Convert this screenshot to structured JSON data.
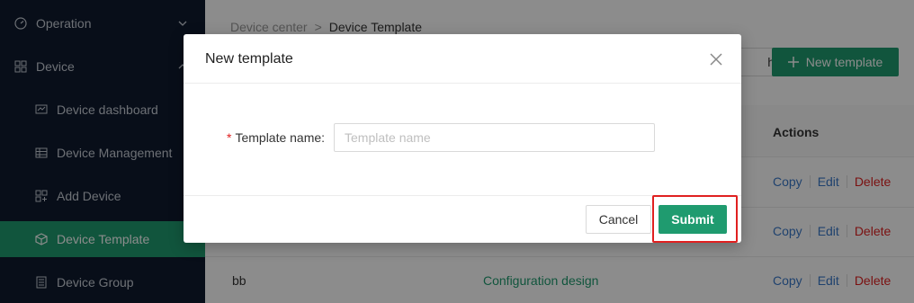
{
  "sidebar": {
    "items": [
      {
        "label": "Operation",
        "icon": "dashboard-gauge-icon",
        "expandable": true
      },
      {
        "label": "Device",
        "icon": "grid-icon",
        "expandable": true
      },
      {
        "label": "Device dashboard",
        "icon": "monitor-chart-icon"
      },
      {
        "label": "Device Management",
        "icon": "table-icon"
      },
      {
        "label": "Add Device",
        "icon": "add-device-icon"
      },
      {
        "label": "Device Template",
        "icon": "template-cube-icon",
        "active": true
      },
      {
        "label": "Device Group",
        "icon": "group-list-icon"
      }
    ],
    "active_color": "#1f9b6f"
  },
  "breadcrumb": {
    "parent": "Device center",
    "separator": ">",
    "current": "Device Template"
  },
  "toolbar": {
    "search_label": "h",
    "new_template_label": "New template"
  },
  "table": {
    "actions_header": "Actions",
    "rows": [
      {
        "name": "",
        "design": "",
        "actions": [
          "Copy",
          "Edit",
          "Delete"
        ]
      },
      {
        "name": "",
        "design": "",
        "actions": [
          "Copy",
          "Edit",
          "Delete"
        ]
      },
      {
        "name": "bb",
        "design": "Configuration design",
        "actions": [
          "Copy",
          "Edit",
          "Delete"
        ]
      }
    ]
  },
  "modal": {
    "title": "New template",
    "field_label": "Template name",
    "field_required_mark": "*",
    "field_colon": ":",
    "field_placeholder": "Template name",
    "field_value": "",
    "cancel_label": "Cancel",
    "submit_label": "Submit"
  },
  "colors": {
    "primary": "#1f9b6f",
    "danger": "#e02020",
    "link": "#3a78c9",
    "sidebar_bg": "#0f1b2e"
  }
}
